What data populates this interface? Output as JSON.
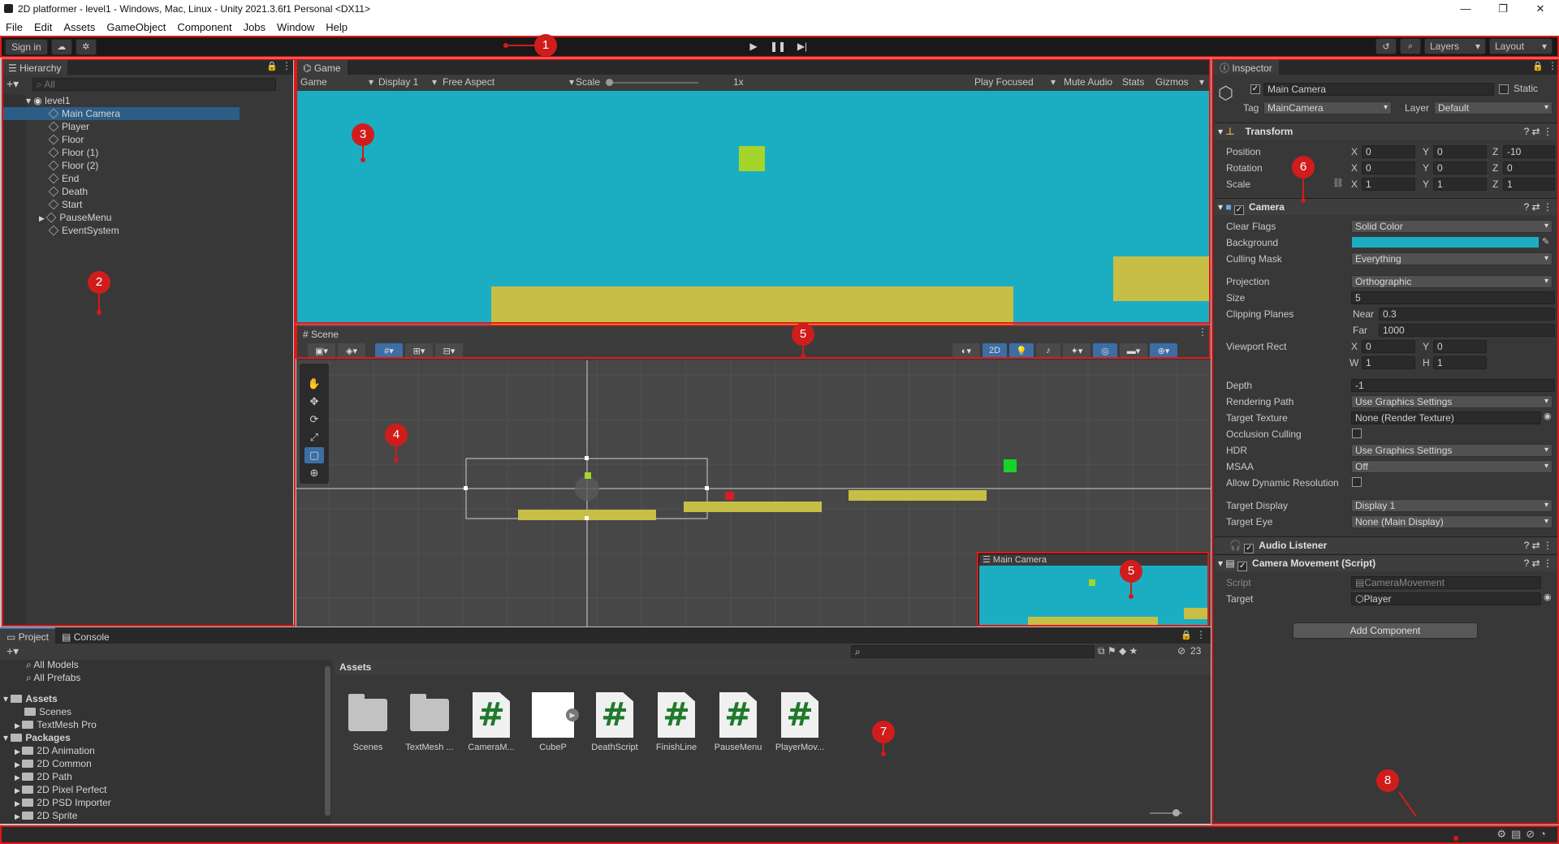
{
  "window": {
    "title": "2D platformer - level1 - Windows, Mac, Linux - Unity 2021.3.6f1 Personal <DX11>",
    "controls": [
      "—",
      "❐",
      "✕"
    ]
  },
  "menu": [
    "File",
    "Edit",
    "Assets",
    "GameObject",
    "Component",
    "Jobs",
    "Window",
    "Help"
  ],
  "toolbar": {
    "sign_in": "Sign in",
    "layers": "Layers",
    "layout": "Layout"
  },
  "hierarchy": {
    "tab": "Hierarchy",
    "search_placeholder": "All",
    "scene": "level1",
    "items": [
      "Main Camera",
      "Player",
      "Floor",
      "Floor (1)",
      "Floor (2)",
      "End",
      "Death",
      "Start",
      "PauseMenu",
      "EventSystem"
    ],
    "selected": "Main Camera"
  },
  "game": {
    "tab": "Game",
    "view_dd": "Game",
    "display_dd": "Display 1",
    "aspect_dd": "Free Aspect",
    "scale_label": "Scale",
    "scale_value": "1x",
    "play_focused": "Play Focused",
    "mute": "Mute Audio",
    "stats": "Stats",
    "gizmos": "Gizmos",
    "sky_color": "#1baec3",
    "ground_color": "#c7bf45",
    "player_color": "#a5d42a"
  },
  "scene": {
    "tab": "Scene",
    "btn_2d": "2D",
    "preview_title": "Main Camera",
    "bg_color": "#474747",
    "death_color": "#d61e27",
    "end_color": "#19d328"
  },
  "inspector": {
    "tab": "Inspector",
    "object_name": "Main Camera",
    "static_label": "Static",
    "tag_label": "Tag",
    "tag_value": "MainCamera",
    "layer_label": "Layer",
    "layer_value": "Default",
    "transform": {
      "title": "Transform",
      "position_label": "Position",
      "position": [
        "0",
        "0",
        "-10"
      ],
      "rotation_label": "Rotation",
      "rotation": [
        "0",
        "0",
        "0"
      ],
      "scale_label": "Scale",
      "scale": [
        "1",
        "1",
        "1"
      ]
    },
    "camera": {
      "title": "Camera",
      "clear_flags_label": "Clear Flags",
      "clear_flags": "Solid Color",
      "background_label": "Background",
      "background_color": "#1baec3",
      "culling_mask_label": "Culling Mask",
      "culling_mask": "Everything",
      "projection_label": "Projection",
      "projection": "Orthographic",
      "size_label": "Size",
      "size": "5",
      "clipping_label": "Clipping Planes",
      "near_label": "Near",
      "near": "0.3",
      "far_label": "Far",
      "far": "1000",
      "viewport_label": "Viewport Rect",
      "vx": "0",
      "vy": "0",
      "vw": "1",
      "vh": "1",
      "depth_label": "Depth",
      "depth": "-1",
      "rendering_path_label": "Rendering Path",
      "rendering_path": "Use Graphics Settings",
      "target_texture_label": "Target Texture",
      "target_texture": "None (Render Texture)",
      "occlusion_label": "Occlusion Culling",
      "hdr_label": "HDR",
      "hdr": "Use Graphics Settings",
      "msaa_label": "MSAA",
      "msaa": "Off",
      "dyn_res_label": "Allow Dynamic Resolution",
      "target_display_label": "Target Display",
      "target_display": "Display 1",
      "target_eye_label": "Target Eye",
      "target_eye": "None (Main Display)"
    },
    "audio_listener": "Audio Listener",
    "camera_movement": {
      "title": "Camera Movement (Script)",
      "script_label": "Script",
      "script": "CameraMovement",
      "target_label": "Target",
      "target": "Player"
    },
    "add_component": "Add Component"
  },
  "project": {
    "tab": "Project",
    "console_tab": "Console",
    "hidden_count": "23",
    "tree": [
      "All Models",
      "All Prefabs",
      "Assets",
      "Scenes",
      "TextMesh Pro",
      "Packages",
      "2D Animation",
      "2D Common",
      "2D Path",
      "2D Pixel Perfect",
      "2D PSD Importer",
      "2D Sprite"
    ],
    "breadcrumb": "Assets",
    "assets": [
      {
        "name": "Scenes",
        "kind": "folder"
      },
      {
        "name": "TextMesh ...",
        "kind": "folder"
      },
      {
        "name": "CameraM...",
        "kind": "script"
      },
      {
        "name": "CubeP",
        "kind": "prefab"
      },
      {
        "name": "DeathScript",
        "kind": "script"
      },
      {
        "name": "FinishLine",
        "kind": "script"
      },
      {
        "name": "PauseMenu",
        "kind": "script"
      },
      {
        "name": "PlayerMov...",
        "kind": "script"
      }
    ]
  },
  "annotations": [
    "1",
    "2",
    "3",
    "4",
    "5",
    "5",
    "6",
    "7",
    "8"
  ]
}
